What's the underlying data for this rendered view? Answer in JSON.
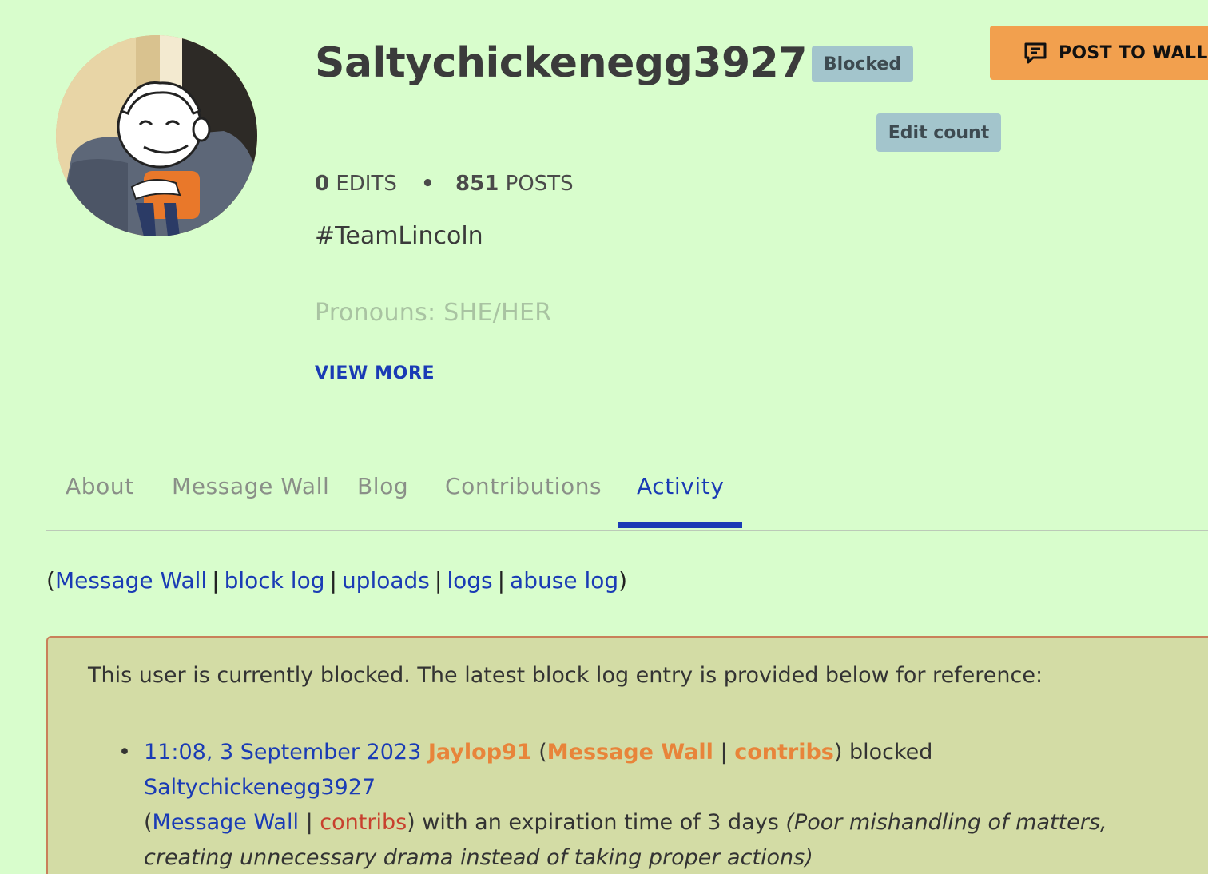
{
  "profile": {
    "username": "Saltychickenegg3927",
    "blocked_badge": "Blocked",
    "post_to_wall": "POST TO WALL",
    "edit_count": "Edit count",
    "edits_count": "0",
    "edits_label": "EDITS",
    "separator": "•",
    "posts_count": "851",
    "posts_label": "POSTS",
    "bio": "#TeamLincoln",
    "pronouns": "Pronouns: SHE/HER",
    "view_more": "VIEW MORE"
  },
  "tabs": [
    {
      "label": "About"
    },
    {
      "label": "Message Wall"
    },
    {
      "label": "Blog"
    },
    {
      "label": "Contributions"
    },
    {
      "label": "Activity",
      "active": true
    }
  ],
  "links": {
    "open": "(",
    "close": ")",
    "sep": "|",
    "items": [
      "Message Wall",
      "block log",
      "uploads",
      "logs",
      "abuse log"
    ]
  },
  "notice": {
    "text": "This user is currently blocked. The latest block log entry is provided below for reference:",
    "entry": {
      "bullet": "•",
      "timestamp": "11:08, 3 September 2023",
      "blocker": "Jaylop91",
      "blocker_wall": "Message Wall",
      "blocker_contribs": "contribs",
      "action": "blocked",
      "target": "Saltychickenegg3927",
      "target_wall": "Message Wall",
      "target_contribs": "contribs",
      "expiry_text": "with an expiration time of 3 days",
      "reason": "(Poor mishandling of matters, creating unnecessary drama instead of taking proper actions)"
    }
  },
  "colors": {
    "background": "#d8fdcc",
    "link": "#1a3bb5",
    "accent_orange": "#f2a04e",
    "badge": "#a3c5cc",
    "notice_bg": "#d3dca5",
    "notice_border": "#c9805a"
  }
}
